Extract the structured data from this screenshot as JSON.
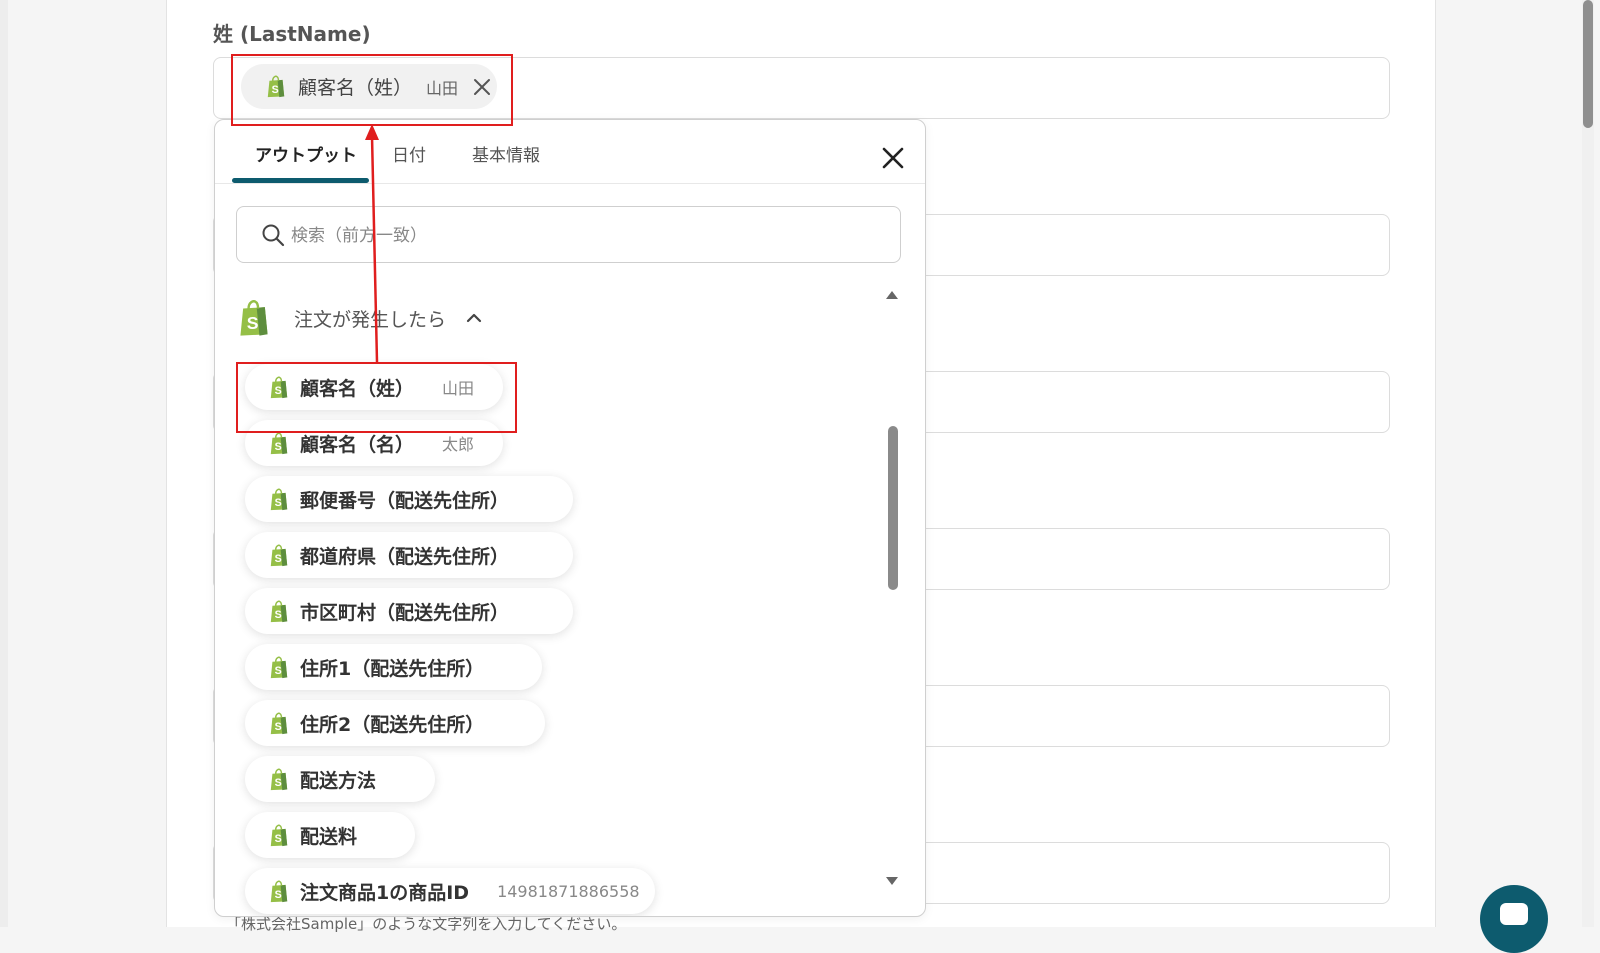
{
  "form": {
    "lastname_label": "姓 (LastName)",
    "hint_text": "「株式会社Sample」のような文字列を入力してください。"
  },
  "selected_chip": {
    "icon": "shopify-icon",
    "label": "顧客名（姓）",
    "value": "山田",
    "remove_icon": "close-icon"
  },
  "dropdown": {
    "tabs": [
      {
        "label": "アウトプット",
        "active": true
      },
      {
        "label": "日付",
        "active": false
      },
      {
        "label": "基本情報",
        "active": false
      }
    ],
    "search_placeholder": "検索（前方一致）",
    "group": {
      "icon": "shopify-icon",
      "label": "注文が発生したら",
      "expanded": true
    },
    "items": [
      {
        "label": "顧客名（姓）",
        "value": "山田"
      },
      {
        "label": "顧客名（名）",
        "value": "太郎"
      },
      {
        "label": "郵便番号（配送先住所）",
        "value": ""
      },
      {
        "label": "都道府県（配送先住所）",
        "value": ""
      },
      {
        "label": "市区町村（配送先住所）",
        "value": ""
      },
      {
        "label": "住所1（配送先住所）",
        "value": ""
      },
      {
        "label": "住所2（配送先住所）",
        "value": ""
      },
      {
        "label": "配送方法",
        "value": ""
      },
      {
        "label": "配送料",
        "value": ""
      },
      {
        "label": "注文商品1の商品ID",
        "value": "14981871886558"
      }
    ]
  },
  "colors": {
    "accent": "#0d5b6e",
    "highlight_red": "#e01e1e",
    "shopify_green": "#95bf47"
  }
}
